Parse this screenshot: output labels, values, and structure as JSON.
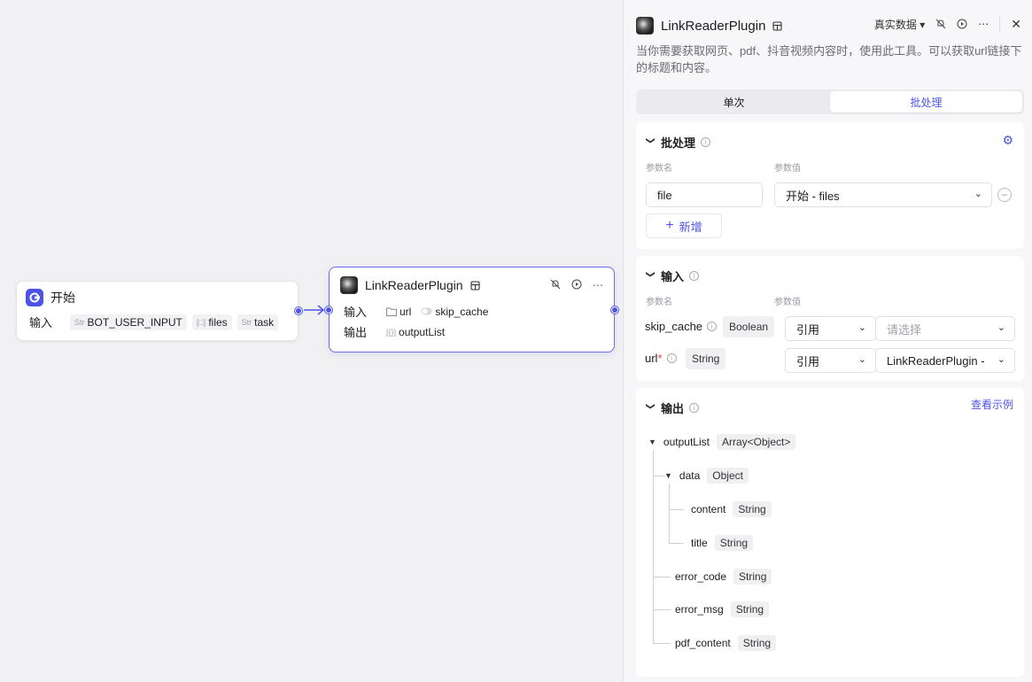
{
  "canvas": {
    "start_node": {
      "title": "开始",
      "input_label": "输入",
      "inputs": [
        {
          "icon": "Str",
          "name": "BOT_USER_INPUT"
        },
        {
          "icon": "[□]",
          "name": "files"
        },
        {
          "icon": "Str",
          "name": "task"
        }
      ]
    },
    "plugin_node": {
      "title": "LinkReaderPlugin",
      "input_label": "输入",
      "output_label": "输出",
      "inputs": [
        {
          "icon": "folder",
          "name": "url"
        },
        {
          "icon": "toggle",
          "name": "skip_cache"
        }
      ],
      "outputs": [
        {
          "icon": "[{}]",
          "name": "outputList"
        }
      ]
    }
  },
  "panel": {
    "title": "LinkReaderPlugin",
    "data_mode": "真实数据",
    "description": "当你需要获取网页、pdf、抖音视频内容时，使用此工具。可以获取url链接下的标题和内容。",
    "tabs": [
      {
        "label": "单次",
        "active": false
      },
      {
        "label": "批处理",
        "active": true
      }
    ],
    "batch": {
      "title": "批处理",
      "col_name": "参数名",
      "col_value": "参数值",
      "param_name": "file",
      "param_value": "开始 - files",
      "add_label": "新增"
    },
    "input": {
      "title": "输入",
      "col_name": "参数名",
      "col_value": "参数值",
      "params": [
        {
          "name": "skip_cache",
          "required": false,
          "type": "Boolean",
          "mode": "引用",
          "value": "请选择",
          "placeholder": true
        },
        {
          "name": "url",
          "required": true,
          "type": "String",
          "mode": "引用",
          "value": "LinkReaderPlugin -",
          "placeholder": false
        }
      ]
    },
    "output": {
      "title": "输出",
      "view_example": "查看示例",
      "tree": [
        {
          "name": "outputList",
          "type": "Array<Object>"
        },
        {
          "name": "data",
          "type": "Object"
        },
        {
          "name": "content",
          "type": "String"
        },
        {
          "name": "title",
          "type": "String"
        },
        {
          "name": "error_code",
          "type": "String"
        },
        {
          "name": "error_msg",
          "type": "String"
        },
        {
          "name": "pdf_content",
          "type": "String"
        }
      ]
    }
  },
  "colors": {
    "accent": "#4d53e8",
    "required": "#e04545"
  }
}
